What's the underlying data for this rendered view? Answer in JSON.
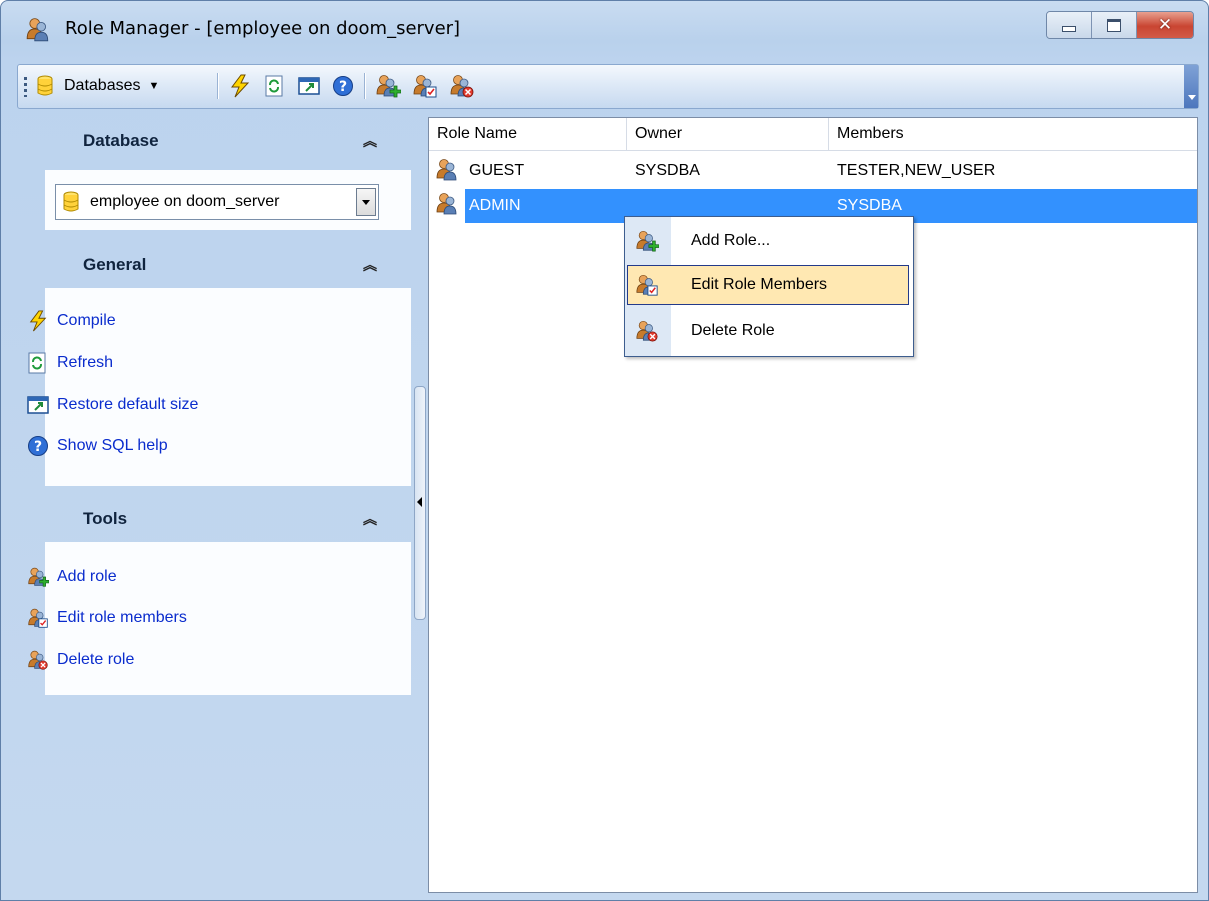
{
  "window": {
    "title": "Role Manager - [employee on doom_server]",
    "caption_buttons": [
      "minimize",
      "maximize",
      "close"
    ]
  },
  "toolbar": {
    "databases_label": "Databases",
    "buttons": [
      "compile",
      "refresh",
      "restore-default-size",
      "show-sql-help",
      "add-role",
      "edit-role-members",
      "delete-role"
    ]
  },
  "nav": {
    "database": {
      "title": "Database",
      "selected_db": "employee on doom_server"
    },
    "general": {
      "title": "General",
      "items": [
        {
          "label": "Compile",
          "icon": "lightning-icon"
        },
        {
          "label": "Refresh",
          "icon": "refresh-icon"
        },
        {
          "label": "Restore default size",
          "icon": "restore-size-icon"
        },
        {
          "label": "Show SQL help",
          "icon": "help-icon"
        }
      ]
    },
    "tools": {
      "title": "Tools",
      "items": [
        {
          "label": "Add role",
          "icon": "add-role-icon"
        },
        {
          "label": "Edit role members",
          "icon": "edit-role-members-icon"
        },
        {
          "label": "Delete role",
          "icon": "delete-role-icon"
        }
      ]
    }
  },
  "grid": {
    "columns": [
      "Role Name",
      "Owner",
      "Members"
    ],
    "rows": [
      {
        "name": "GUEST",
        "owner": "SYSDBA",
        "members": "TESTER,NEW_USER",
        "selected": false
      },
      {
        "name": "ADMIN",
        "owner": "",
        "members": "SYSDBA",
        "selected": true
      }
    ]
  },
  "context_menu": {
    "items": [
      {
        "label": "Add Role...",
        "icon": "add-role-icon",
        "highlighted": false
      },
      {
        "label": "Edit Role Members",
        "icon": "edit-role-members-icon",
        "highlighted": true
      },
      {
        "label": "Delete Role",
        "icon": "delete-role-icon",
        "highlighted": false
      }
    ]
  },
  "colors": {
    "selection": "#3391fe",
    "link": "#0a2ccd",
    "menu_highlight": "#ffe8b2"
  }
}
